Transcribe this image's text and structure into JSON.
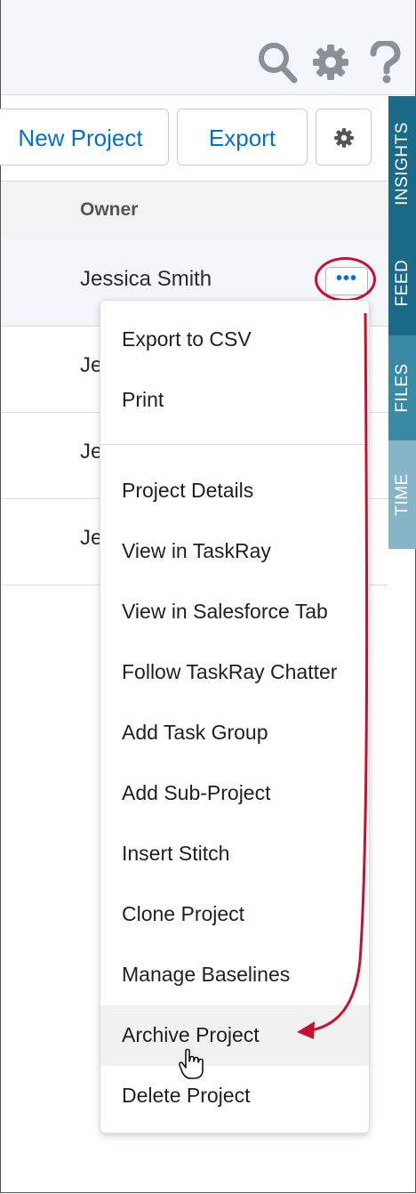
{
  "toolbar": {
    "new_project_label": "New Project",
    "export_label": "Export"
  },
  "table": {
    "owner_header": "Owner",
    "rows": [
      "Jessica Smith",
      "Je",
      "Je",
      "Je"
    ]
  },
  "more_button": {
    "label": "•••"
  },
  "side_tabs": [
    {
      "label": "INSIGHTS",
      "color": "#1b6a87"
    },
    {
      "label": "FEED",
      "color": "#1b6a87"
    },
    {
      "label": "FILES",
      "color": "#3a8aa5"
    },
    {
      "label": "TIME",
      "color": "#85b5c7"
    }
  ],
  "menu": {
    "items": [
      "Export to CSV",
      "Print",
      "Project Details",
      "View in TaskRay",
      "View in Salesforce Tab",
      "Follow TaskRay Chatter",
      "Add Task Group",
      "Add Sub-Project",
      "Insert Stitch",
      "Clone Project",
      "Manage Baselines",
      "Archive Project",
      "Delete Project"
    ],
    "highlighted": "Archive Project"
  },
  "icons": {
    "search": "search-icon",
    "gear": "gear-icon",
    "help": "help-icon",
    "settings": "gear-icon",
    "pointer": "hand-pointer-icon"
  },
  "colors": {
    "accent": "#0070d2",
    "annotation": "#c8102e",
    "icon_grey": "#8a9099"
  }
}
